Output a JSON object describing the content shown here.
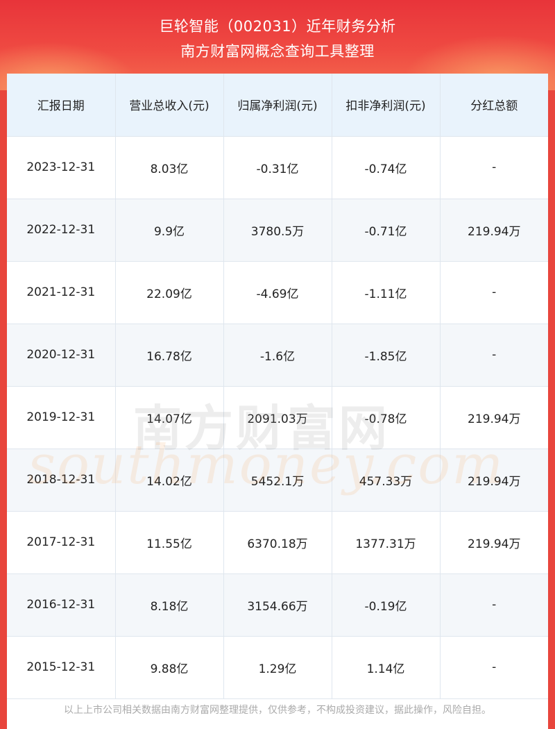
{
  "header": {
    "title_line1": "巨轮智能（002031）近年财务分析",
    "title_line2": "南方财富网概念查询工具整理"
  },
  "table": {
    "columns": [
      "汇报日期",
      "营业总收入(元)",
      "归属净利润(元)",
      "扣非净利润(元)",
      "分红总额"
    ],
    "rows": [
      [
        "2023-12-31",
        "8.03亿",
        "-0.31亿",
        "-0.74亿",
        "-"
      ],
      [
        "2022-12-31",
        "9.9亿",
        "3780.5万",
        "-0.71亿",
        "219.94万"
      ],
      [
        "2021-12-31",
        "22.09亿",
        "-4.69亿",
        "-1.11亿",
        "-"
      ],
      [
        "2020-12-31",
        "16.78亿",
        "-1.6亿",
        "-1.85亿",
        "-"
      ],
      [
        "2019-12-31",
        "14.07亿",
        "2091.03万",
        "-0.78亿",
        "219.94万"
      ],
      [
        "2018-12-31",
        "14.02亿",
        "5452.1万",
        "457.33万",
        "219.94万"
      ],
      [
        "2017-12-31",
        "11.55亿",
        "6370.18万",
        "1377.31万",
        "219.94万"
      ],
      [
        "2016-12-31",
        "8.18亿",
        "3154.66万",
        "-0.19亿",
        "-"
      ],
      [
        "2015-12-31",
        "9.88亿",
        "1.29亿",
        "1.14亿",
        "-"
      ]
    ]
  },
  "watermark": {
    "cn": "南方财富网",
    "en": "southmoney.com"
  },
  "footer": {
    "disclaimer": "以上上市公司相关数据由南方财富网整理提供，仅供参考，不构成投资建议，据此操作，风险自担。"
  },
  "colors": {
    "header_red": "#e8343a",
    "table_header_bg": "#e9f3fc",
    "row_alt_bg": "#f4f7fa"
  }
}
